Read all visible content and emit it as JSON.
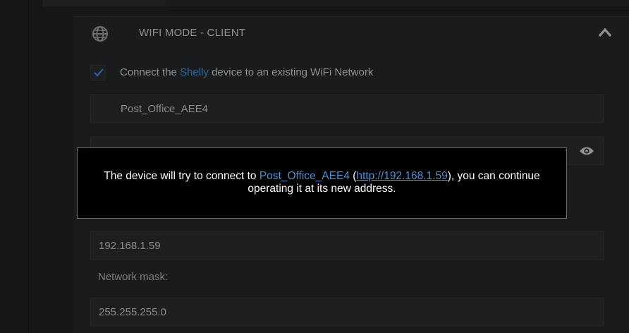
{
  "section": {
    "title": "WIFI MODE - CLIENT",
    "globe_icon": "globe-icon",
    "collapse_icon": "chevron-up-icon"
  },
  "client": {
    "enabled": true,
    "label_prefix": "Connect the ",
    "label_brand": "Shelly",
    "label_suffix": " device to an existing WiFi Network",
    "ssid": "Post_Office_AEE4",
    "password_value": "",
    "show_password_icon": "eye-icon"
  },
  "ip": {
    "address": "192.168.1.59",
    "mask_label": "Network mask:",
    "mask": "255.255.255.0"
  },
  "modal": {
    "text_before": "The device will try to connect to ",
    "ssid": "Post_Office_AEE4",
    "open_paren": " (",
    "url": "http://192.168.1.59",
    "text_after": "), you can continue operating it at its new address."
  },
  "colors": {
    "background": "#151617",
    "panel": "#1a1b1c",
    "accent": "#4a90d9",
    "modal_border": "#3a78a6"
  }
}
